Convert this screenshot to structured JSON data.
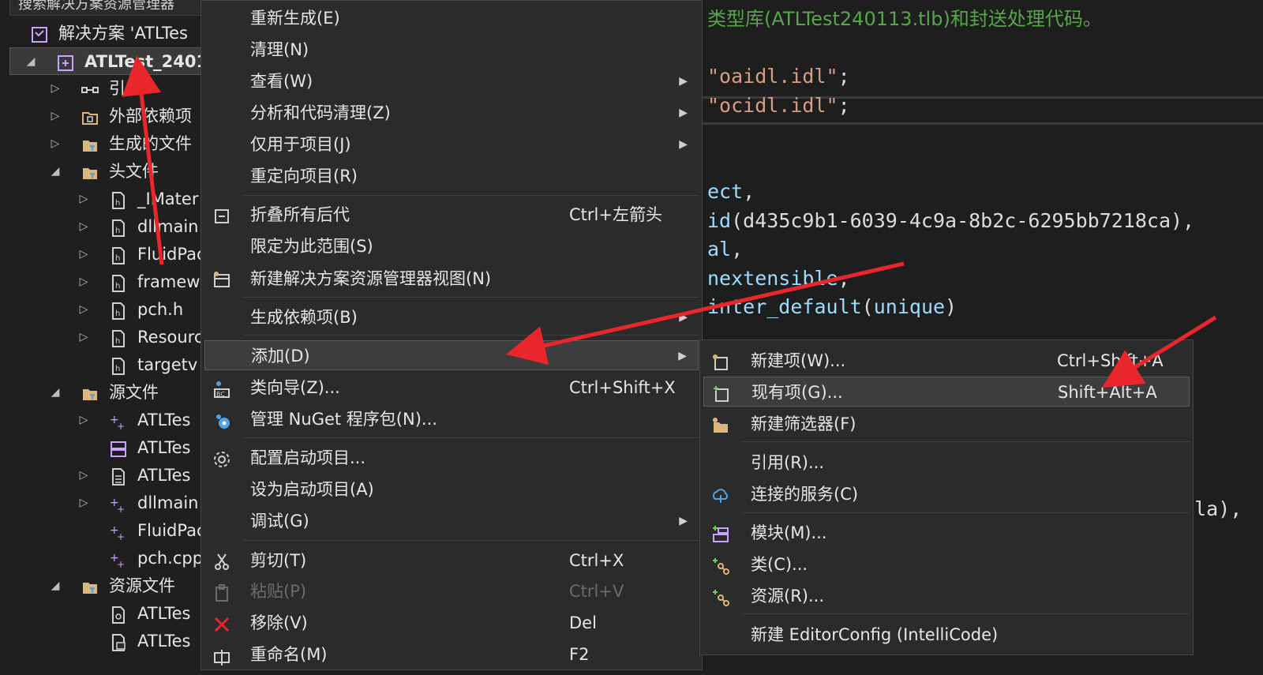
{
  "explorer": {
    "search_placeholder": "搜索解决方案资源管理器",
    "items": [
      {
        "label": "解决方案 'ATLTes",
        "icon": "solution-icon",
        "level": 0,
        "expander": ""
      },
      {
        "label": "ATLTest_2401",
        "icon": "project-icon",
        "level": 0,
        "expander": "◢",
        "selected": true
      },
      {
        "label": "引用",
        "icon": "references-icon",
        "level": 1,
        "expander": "▷"
      },
      {
        "label": "外部依赖项",
        "icon": "external-deps-icon",
        "level": 1,
        "expander": "▷"
      },
      {
        "label": "生成的文件",
        "icon": "filter-folder-icon",
        "level": 1,
        "expander": "▷"
      },
      {
        "label": "头文件",
        "icon": "filter-folder-icon",
        "level": 1,
        "expander": "◢"
      },
      {
        "label": "_IMater",
        "icon": "header-file-icon",
        "level": 2,
        "expander": "▷"
      },
      {
        "label": "dllmain",
        "icon": "header-file-icon",
        "level": 2,
        "expander": "▷"
      },
      {
        "label": "FluidPac",
        "icon": "header-file-icon",
        "level": 2,
        "expander": "▷"
      },
      {
        "label": "framew",
        "icon": "header-file-icon",
        "level": 2,
        "expander": "▷"
      },
      {
        "label": "pch.h",
        "icon": "header-file-icon",
        "level": 2,
        "expander": "▷"
      },
      {
        "label": "Resourc",
        "icon": "header-file-icon",
        "level": 2,
        "expander": "▷"
      },
      {
        "label": "targetv",
        "icon": "header-file-icon",
        "level": 2,
        "expander": ""
      },
      {
        "label": "源文件",
        "icon": "filter-folder-icon",
        "level": 1,
        "expander": "◢"
      },
      {
        "label": "ATLTes",
        "icon": "cpp-file-icon",
        "level": 2,
        "expander": "▷"
      },
      {
        "label": "ATLTes",
        "icon": "def-file-icon",
        "level": 2,
        "expander": ""
      },
      {
        "label": "ATLTes",
        "icon": "idl-file-icon",
        "level": 2,
        "expander": "▷"
      },
      {
        "label": "dllmain",
        "icon": "cpp-file-icon",
        "level": 2,
        "expander": "▷"
      },
      {
        "label": "FluidPac",
        "icon": "cpp-file-icon",
        "level": 2,
        "expander": ""
      },
      {
        "label": "pch.cpp",
        "icon": "cpp-file-icon",
        "level": 2,
        "expander": ""
      },
      {
        "label": "资源文件",
        "icon": "filter-folder-icon",
        "level": 1,
        "expander": "◢"
      },
      {
        "label": "ATLTes",
        "icon": "rc-file-icon",
        "level": 2,
        "expander": ""
      },
      {
        "label": "ATLTes",
        "icon": "rgs-file-icon",
        "level": 2,
        "expander": ""
      }
    ]
  },
  "editor": {
    "lines": [
      {
        "parts": [
          {
            "t": "类型库(ATLTest240113.tlb)和封送处理代码。",
            "c": "c-green"
          }
        ]
      },
      {
        "parts": []
      },
      {
        "parts": [
          {
            "t": "\"oaidl.idl\"",
            "c": "c-str"
          },
          {
            "t": ";",
            "c": "c-w"
          }
        ]
      },
      {
        "parts": [
          {
            "t": "\"ocidl.idl\"",
            "c": "c-str"
          },
          {
            "t": ";",
            "c": "c-w"
          }
        ]
      },
      {
        "parts": []
      },
      {
        "parts": []
      },
      {
        "parts": [
          {
            "t": "ect",
            "c": "c-blue"
          },
          {
            "t": ",",
            "c": "c-w"
          }
        ]
      },
      {
        "parts": [
          {
            "t": "id",
            "c": "c-blue"
          },
          {
            "t": "(d435c9b1-6039-4c9a-8b2c-6295bb7218ca),",
            "c": "c-w"
          }
        ]
      },
      {
        "parts": [
          {
            "t": "al",
            "c": "c-blue"
          },
          {
            "t": ",",
            "c": "c-w"
          }
        ]
      },
      {
        "parts": [
          {
            "t": "nextensible",
            "c": "c-blue"
          },
          {
            "t": ",",
            "c": "c-w"
          }
        ]
      },
      {
        "parts": [
          {
            "t": "inter_default",
            "c": "c-blue"
          },
          {
            "t": "(",
            "c": "c-w"
          },
          {
            "t": "unique",
            "c": "c-blue"
          },
          {
            "t": ")",
            "c": "c-w"
          }
        ]
      },
      {
        "parts": []
      },
      {
        "parts": []
      },
      {
        "parts": []
      },
      {
        "parts": []
      },
      {
        "parts": []
      },
      {
        "parts": []
      },
      {
        "parts": [
          {
            "t": "                                         la),",
            "c": "c-w"
          }
        ]
      }
    ]
  },
  "context_menu": {
    "items": [
      {
        "label": "重新生成(E)",
        "shortcut": "",
        "icon": "",
        "submenu": false
      },
      {
        "label": "清理(N)",
        "shortcut": "",
        "icon": "",
        "submenu": false
      },
      {
        "label": "查看(W)",
        "shortcut": "",
        "icon": "",
        "submenu": true
      },
      {
        "label": "分析和代码清理(Z)",
        "shortcut": "",
        "icon": "",
        "submenu": true
      },
      {
        "label": "仅用于项目(J)",
        "shortcut": "",
        "icon": "",
        "submenu": true
      },
      {
        "label": "重定向项目(R)",
        "shortcut": "",
        "icon": "",
        "submenu": false
      },
      {
        "sep": true
      },
      {
        "label": "折叠所有后代",
        "shortcut": "Ctrl+左箭头",
        "icon": "collapse-all-icon",
        "submenu": false
      },
      {
        "label": "限定为此范围(S)",
        "shortcut": "",
        "icon": "",
        "submenu": false
      },
      {
        "label": "新建解决方案资源管理器视图(N)",
        "shortcut": "",
        "icon": "new-view-icon",
        "submenu": false
      },
      {
        "sep": true
      },
      {
        "label": "生成依赖项(B)",
        "shortcut": "",
        "icon": "",
        "submenu": true
      },
      {
        "sep": true
      },
      {
        "label": "添加(D)",
        "shortcut": "",
        "icon": "",
        "submenu": true,
        "hover": true
      },
      {
        "label": "类向导(Z)...",
        "shortcut": "Ctrl+Shift+X",
        "icon": "class-wizard-icon",
        "submenu": false
      },
      {
        "label": "管理 NuGet 程序包(N)...",
        "shortcut": "",
        "icon": "nuget-icon",
        "submenu": false
      },
      {
        "sep": true
      },
      {
        "label": "配置启动项目...",
        "shortcut": "",
        "icon": "gear-icon",
        "submenu": false
      },
      {
        "label": "设为启动项目(A)",
        "shortcut": "",
        "icon": "",
        "submenu": false
      },
      {
        "label": "调试(G)",
        "shortcut": "",
        "icon": "",
        "submenu": true
      },
      {
        "sep": true
      },
      {
        "label": "剪切(T)",
        "shortcut": "Ctrl+X",
        "icon": "scissors-icon",
        "submenu": false
      },
      {
        "label": "粘贴(P)",
        "shortcut": "Ctrl+V",
        "icon": "paste-icon",
        "submenu": false,
        "disabled": true
      },
      {
        "label": "移除(V)",
        "shortcut": "Del",
        "icon": "remove-icon",
        "submenu": false
      },
      {
        "label": "重命名(M)",
        "shortcut": "F2",
        "icon": "rename-icon",
        "submenu": false
      }
    ]
  },
  "add_submenu": {
    "items": [
      {
        "label": "新建项(W)...",
        "shortcut": "Ctrl+Shift+A",
        "icon": "new-item-icon"
      },
      {
        "label": "现有项(G)...",
        "shortcut": "Shift+Alt+A",
        "icon": "existing-item-icon",
        "hover": true
      },
      {
        "label": "新建筛选器(F)",
        "shortcut": "",
        "icon": "new-filter-icon"
      },
      {
        "sep": true
      },
      {
        "label": "引用(R)...",
        "shortcut": "",
        "icon": ""
      },
      {
        "label": "连接的服务(C)",
        "shortcut": "",
        "icon": "connected-service-icon"
      },
      {
        "sep": true
      },
      {
        "label": "模块(M)...",
        "shortcut": "",
        "icon": "module-icon"
      },
      {
        "label": "类(C)...",
        "shortcut": "",
        "icon": "class-icon"
      },
      {
        "label": "资源(R)...",
        "shortcut": "",
        "icon": "resource-icon"
      },
      {
        "sep": true
      },
      {
        "label": "新建 EditorConfig (IntelliCode)",
        "shortcut": "",
        "icon": ""
      }
    ]
  },
  "colors": {
    "annotation_arrow": "#e8262b",
    "menu_bg": "#2b2b2b",
    "comment_green": "#57a64a"
  }
}
